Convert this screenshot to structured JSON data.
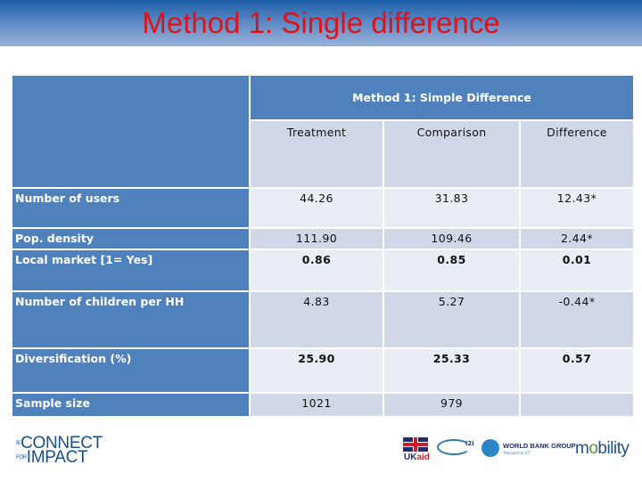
{
  "slide": {
    "title": "Method 1: Single difference"
  },
  "table": {
    "span_header": "Method 1: Simple Difference",
    "columns": [
      "Treatment",
      "Comparison",
      "Difference"
    ],
    "rows": [
      {
        "label": "Number of users",
        "treatment": "44.26",
        "comparison": "31.83",
        "difference": "12.43*"
      },
      {
        "label": "Pop. density",
        "treatment": "111.90",
        "comparison": "109.46",
        "difference": "2.44*"
      },
      {
        "label": "Local market [1= Yes]",
        "treatment": "0.86",
        "comparison": "0.85",
        "difference": "0.01"
      },
      {
        "label": "Number of children per HH",
        "treatment": "4.83",
        "comparison": "5.27",
        "difference": "-0.44*"
      },
      {
        "label": "Diversification (%)",
        "treatment": "25.90",
        "comparison": "25.33",
        "difference": "0.57"
      },
      {
        "label": "Sample size",
        "treatment": "1021",
        "comparison": "979",
        "difference": ""
      }
    ]
  },
  "footer": {
    "left_logo": {
      "prefix": "IE",
      "line1": "CONNECT",
      "for": "FOR",
      "line2": "IMPACT"
    },
    "logos": {
      "ukaid": {
        "uk": "UK",
        "aid": "aid"
      },
      "i2i": "i2i",
      "worldbank": {
        "name": "WORLD BANK GROUP",
        "sub": "Transport & ICT"
      },
      "mobility": {
        "pre": "m",
        "o": "o",
        "post": "bility"
      }
    }
  }
}
